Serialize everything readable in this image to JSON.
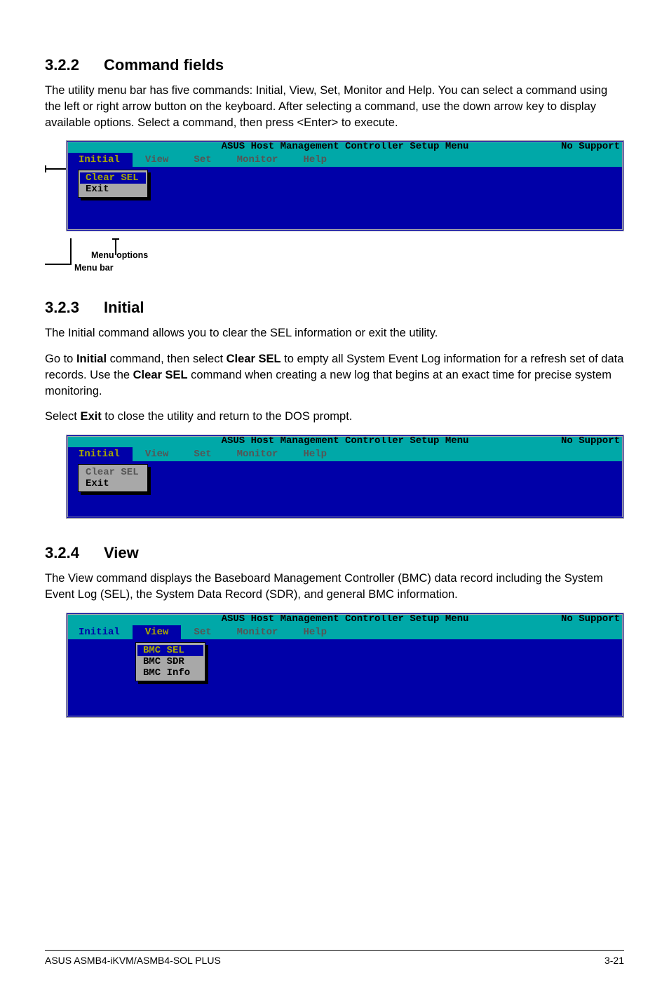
{
  "s1": {
    "num": "3.2.2",
    "title": "Command fields",
    "para": "The utility menu bar has five commands: Initial, View, Set, Monitor and Help. You can select a command using the left or right arrow button on the keyboard. After selecting a command, use the down arrow key to display available options. Select a command, then press <Enter> to execute.",
    "annot_options": "Menu options",
    "annot_bar": "Menu bar"
  },
  "s2": {
    "num": "3.2.3",
    "title": "Initial",
    "p1": "The Initial command allows you to clear the SEL information or exit the utility.",
    "p2a": "Go to ",
    "p2b": "Initial",
    "p2c": " command, then select ",
    "p2d": "Clear SEL",
    "p2e": " to empty all System Event Log information for a refresh set of data records. Use the ",
    "p2f": "Clear SEL",
    "p2g": " command when creating a new log that begins at an exact time for precise system monitoring.",
    "p3a": "Select ",
    "p3b": "Exit",
    "p3c": " to close the utility and return to the DOS prompt."
  },
  "s3": {
    "num": "3.2.4",
    "title": "View",
    "para": "The View command displays the Baseboard Management Controller (BMC) data record including the System Event Log (SEL), the System Data Record (SDR), and general BMC information."
  },
  "dos": {
    "title": "ASUS Host Management Controller Setup Menu",
    "support": "No Support",
    "menu": {
      "initial": "Initial",
      "view": "View",
      "set": "Set",
      "monitor": "Monitor",
      "help": "Help"
    },
    "dd_initial": {
      "clear_sel": "Clear SEL",
      "exit": "Exit"
    },
    "dd_view": {
      "bmc_sel": "BMC SEL",
      "bmc_sdr": "BMC SDR",
      "bmc_info": "BMC Info"
    }
  },
  "footer": {
    "left": "ASUS ASMB4-iKVM/ASMB4-SOL PLUS",
    "right": "3-21"
  }
}
